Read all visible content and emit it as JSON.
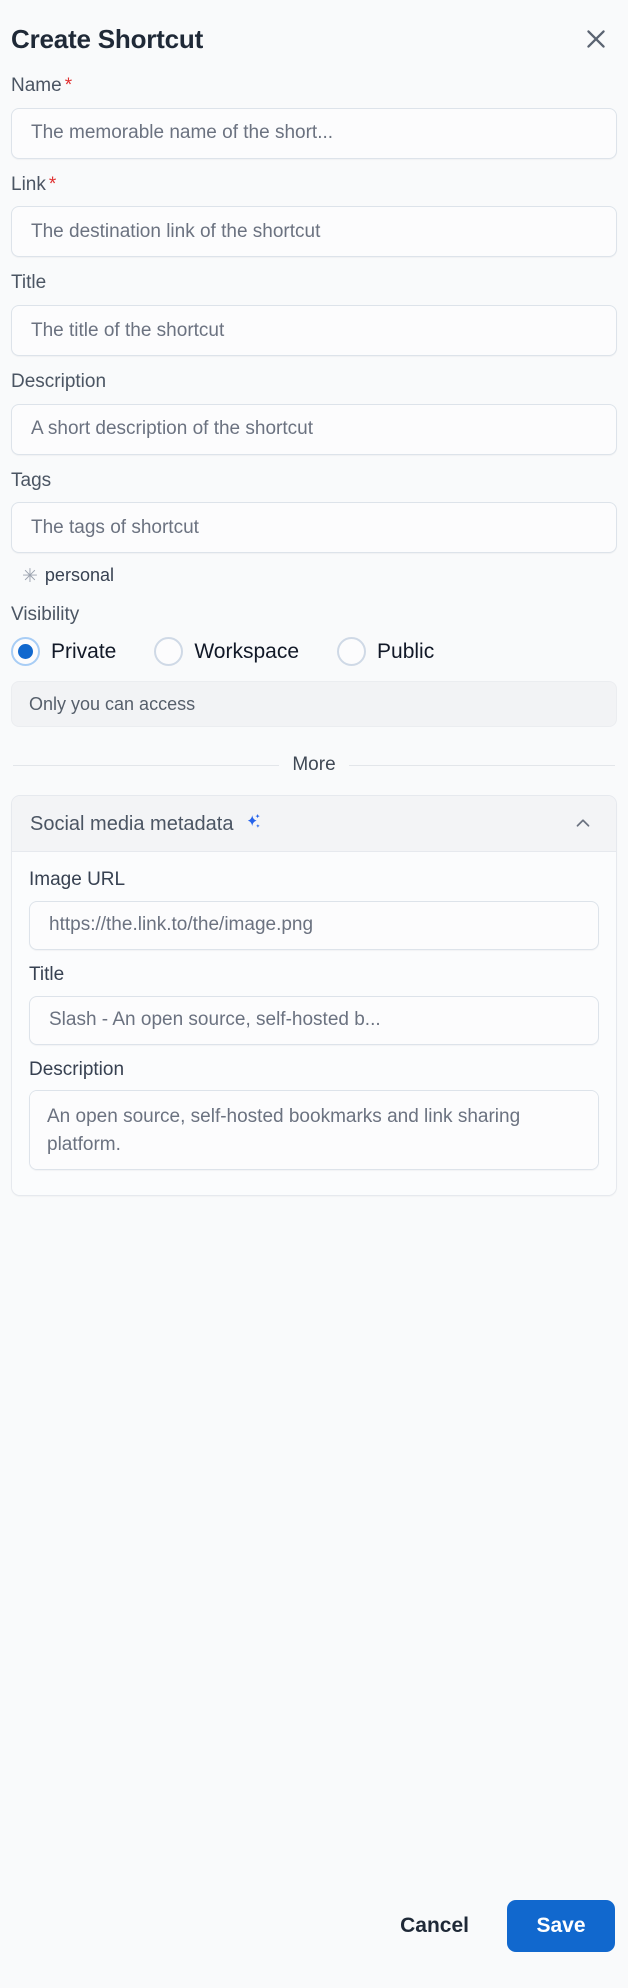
{
  "dialog": {
    "title": "Create Shortcut",
    "close_icon": "close-icon"
  },
  "form": {
    "name": {
      "label": "Name",
      "required_mark": "*",
      "placeholder": "The memorable name of the short...",
      "value": ""
    },
    "link": {
      "label": "Link",
      "required_mark": "*",
      "placeholder": "The destination link of the shortcut",
      "value": ""
    },
    "title": {
      "label": "Title",
      "placeholder": "The title of the shortcut",
      "value": ""
    },
    "description": {
      "label": "Description",
      "placeholder": "A short description of the shortcut",
      "value": ""
    },
    "tags": {
      "label": "Tags",
      "placeholder": "The tags of shortcut",
      "value": "",
      "suggestions": [
        {
          "icon": "asterisk-icon",
          "glyph": "✳",
          "label": "personal"
        }
      ]
    },
    "visibility": {
      "label": "Visibility",
      "selected": "Private",
      "options": [
        {
          "label": "Private",
          "selected": true
        },
        {
          "label": "Workspace",
          "selected": false
        },
        {
          "label": "Public",
          "selected": false
        }
      ],
      "note": "Only you can access"
    }
  },
  "more_divider": {
    "label": "More"
  },
  "social_panel": {
    "title": "Social media metadata",
    "sparkle_icon": "sparkles-icon",
    "collapse_icon": "chevron-up-icon",
    "expanded": true,
    "fields": {
      "image_url": {
        "label": "Image URL",
        "placeholder": "https://the.link.to/the/image.png",
        "value": ""
      },
      "title": {
        "label": "Title",
        "placeholder": "Slash - An open source, self-hosted b...",
        "value": ""
      },
      "description": {
        "label": "Description",
        "placeholder": "An open source, self-hosted bookmarks and link sharing platform.",
        "value": ""
      }
    }
  },
  "footer": {
    "cancel_label": "Cancel",
    "save_label": "Save"
  },
  "colors": {
    "accent": "#1168ce",
    "required": "#e03131",
    "background": "#f9fafb",
    "sparkle": "#2563eb",
    "border": "#dde3ea"
  }
}
